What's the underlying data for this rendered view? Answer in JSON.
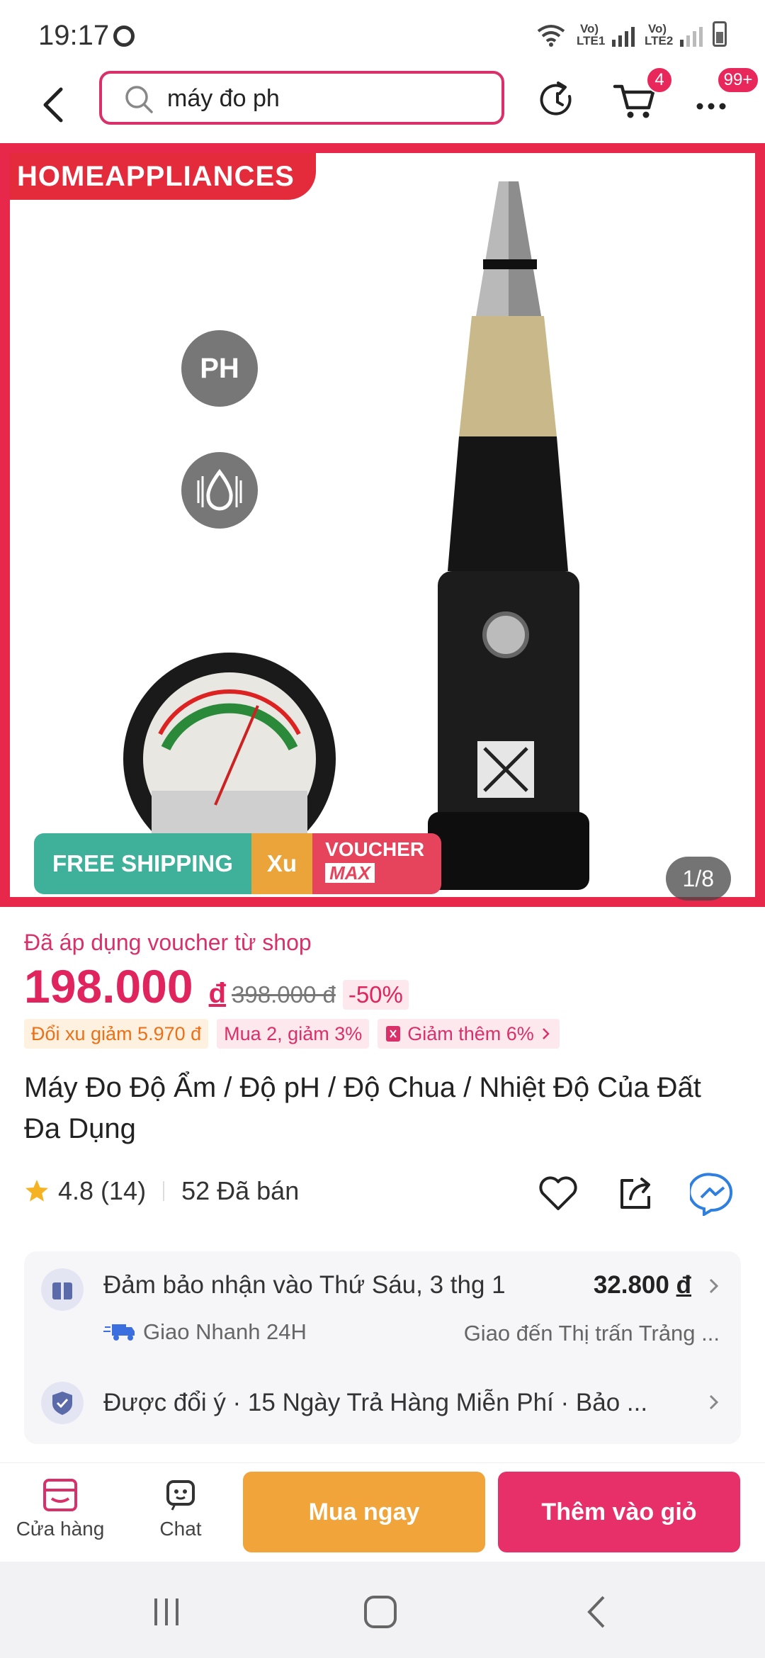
{
  "status_bar": {
    "time": "19:17",
    "sim1": "Vo) LTE1",
    "sim2": "Vo) LTE2"
  },
  "header": {
    "search_value": "máy đo ph",
    "cart_count": "4",
    "more_count": "99+"
  },
  "gallery": {
    "brand_tag": "HOMEAPPLIANCES",
    "feature_ph": "PH",
    "promo_free_shipping": "FREE SHIPPING",
    "promo_xu": "Xu",
    "promo_voucher": "VOUCHER",
    "promo_max": "MAX",
    "counter": "1/8"
  },
  "price": {
    "voucher_note": "Đã áp dụng voucher từ shop",
    "current": "198.000",
    "currency": "đ",
    "original": "398.000 đ",
    "discount": "-50%"
  },
  "tags": [
    "Đổi xu giảm 5.970 đ",
    "Mua 2, giảm 3%",
    "Giảm thêm 6%"
  ],
  "product": {
    "title": "Máy Đo Độ Ẩm / Độ pH / Độ Chua / Nhiệt Độ Của Đất Đa Dụng",
    "rating": "4.8",
    "review_count": "(14)",
    "sold": "52 Đã bán"
  },
  "shipping": {
    "guarantee": "Đảm bảo nhận vào Thứ Sáu, 3 thg 1",
    "fee": "32.800",
    "fee_currency": "đ",
    "express": "Giao Nhanh 24H",
    "destination": "Giao đến Thị trấn Trảng ...",
    "returns": "Được đổi ý  ·  15 Ngày Trả Hàng Miễn Phí  ·  Bảo ..."
  },
  "bottom_bar": {
    "shop": "Cửa hàng",
    "chat": "Chat",
    "buy_now": "Mua ngay",
    "add_to_cart": "Thêm vào giỏ"
  },
  "colors": {
    "accent": "#e0245e",
    "buy_now": "#f0a43a",
    "add_to_cart": "#e7306a"
  }
}
